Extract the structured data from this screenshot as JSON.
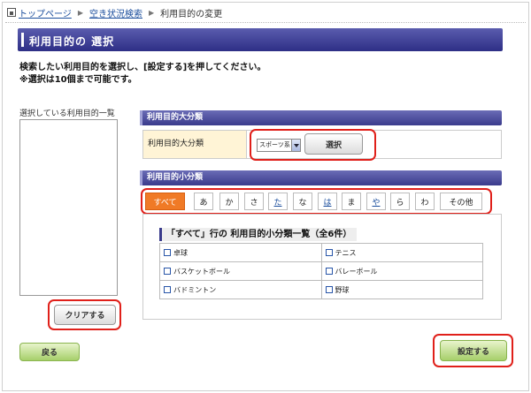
{
  "breadcrumb": {
    "home": "トップページ",
    "search": "空き状況検索",
    "current": "利用目的の変更"
  },
  "page_title": "利用目的の 選択",
  "instructions": {
    "line1": "検索したい利用目的を選択し、[設定する]を押してください。",
    "line2": "※選択は10個まで可能です。"
  },
  "selected_list": {
    "label": "選択している利用目的一覧"
  },
  "clear_button": "クリアする",
  "back_button": "戻る",
  "set_button": "設定する",
  "major": {
    "header": "利用目的大分類",
    "row_label": "利用目的大分類",
    "selected_value": "スポーツ系",
    "select_button": "選択"
  },
  "minor": {
    "header": "利用目的小分類",
    "tabs": [
      "すべて",
      "あ",
      "か",
      "さ",
      "た",
      "な",
      "は",
      "ま",
      "や",
      "ら",
      "わ",
      "その他"
    ],
    "active_tab": "すべて",
    "list_title": "「すべて」行の 利用目的小分類一覧（全6件）",
    "items": [
      "卓球",
      "テニス",
      "バスケットボール",
      "バレーボール",
      "バドミントン",
      "野球"
    ]
  },
  "colors": {
    "title_bar": "#2e2f86",
    "active_tab": "#f07a26",
    "highlight_ring": "#e0201a",
    "green_button": "#a6cf6a",
    "major_label_bg": "#fff4d6"
  }
}
